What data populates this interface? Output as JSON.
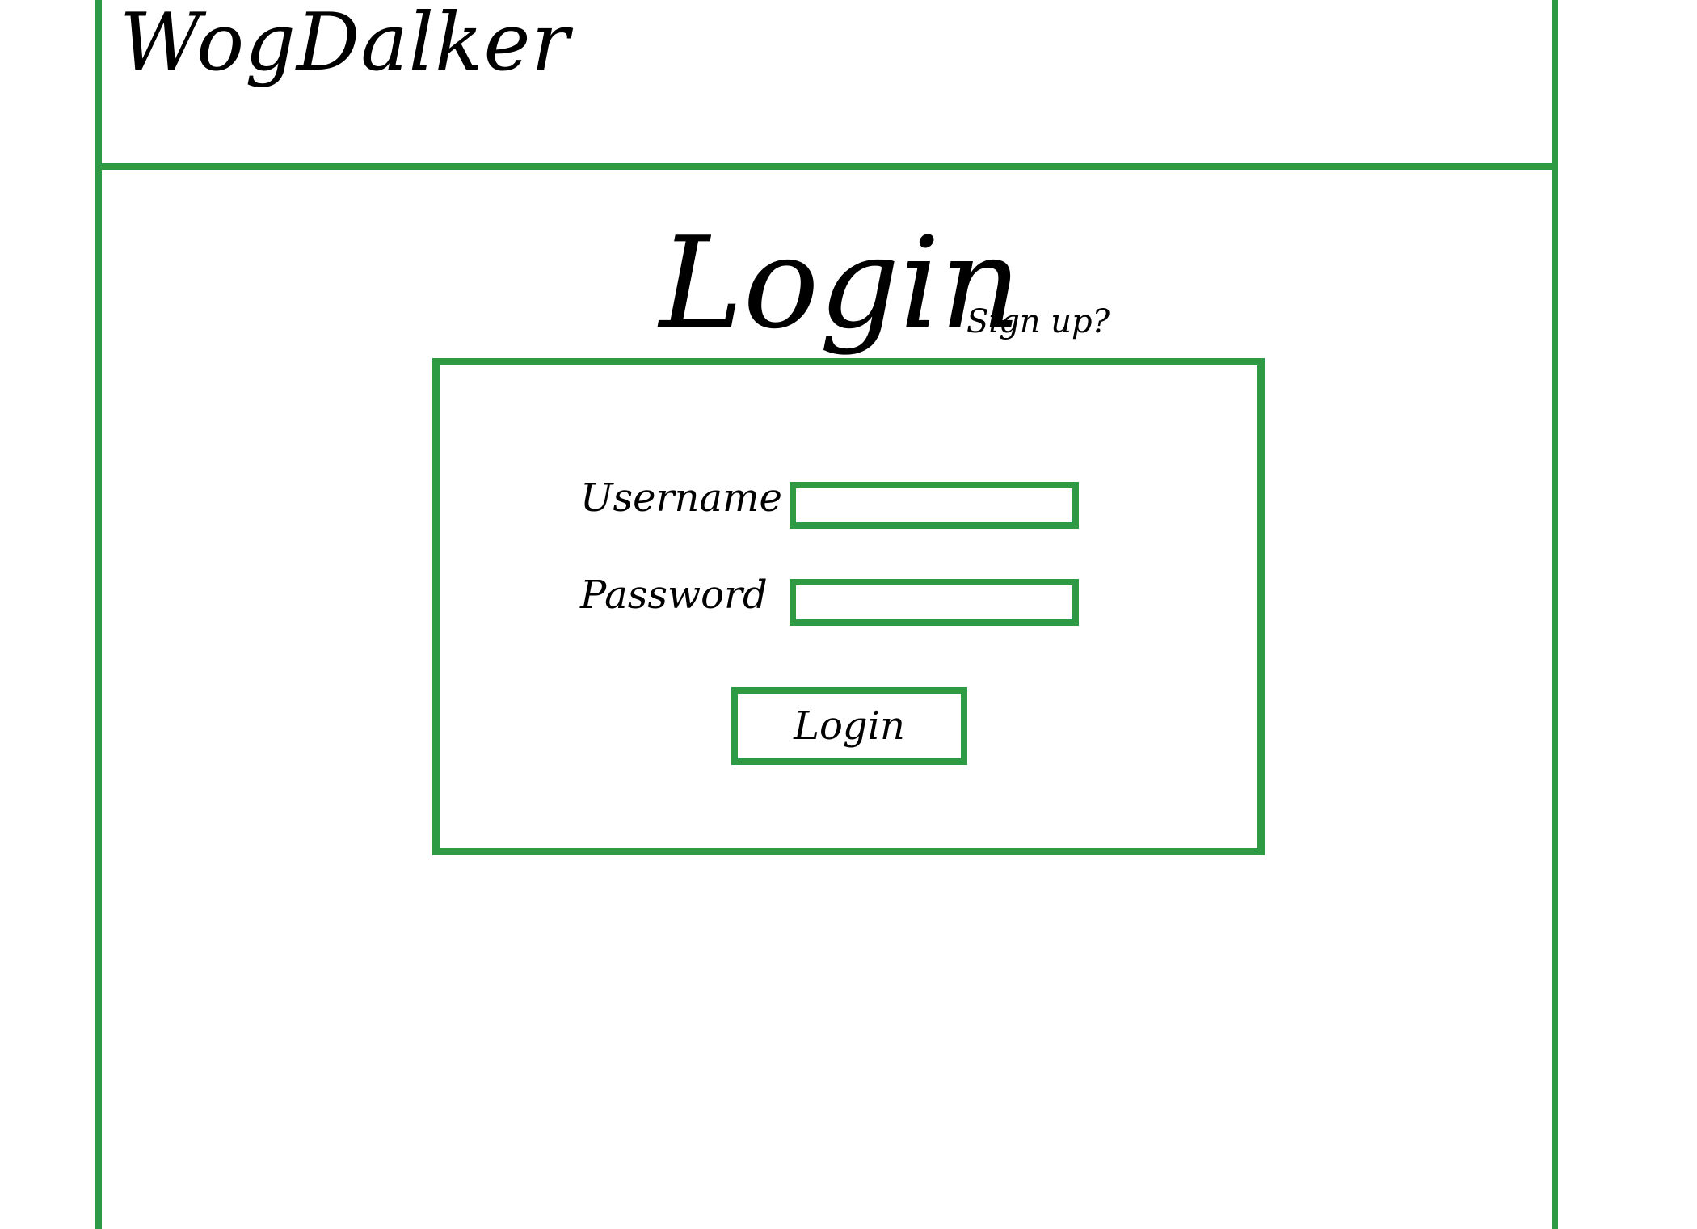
{
  "app": {
    "title": "WogDalker"
  },
  "colors": {
    "accent": "#2e9a44",
    "text": "#000000",
    "background": "#ffffff"
  },
  "login_page": {
    "heading": "Login",
    "signup_link": "Sign up?",
    "form": {
      "username": {
        "label": "Username",
        "value": "",
        "placeholder": ""
      },
      "password": {
        "label": "Password",
        "value": "",
        "placeholder": ""
      },
      "submit_label": "Login"
    }
  }
}
